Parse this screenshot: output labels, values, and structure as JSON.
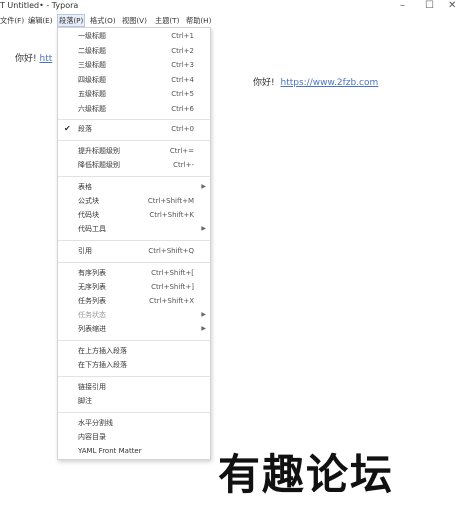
{
  "window": {
    "title": "T  Untitled• - Typora",
    "minimize_glyph": "–",
    "maximize_glyph": "☐",
    "close_glyph": "✕"
  },
  "menubar": {
    "items": [
      "文件(F)",
      "编辑(E)",
      "段落(P)",
      "格式(O)",
      "视图(V)",
      "主题(T)",
      "帮助(H)"
    ],
    "active_index": 2
  },
  "document": {
    "left_text": "你好!",
    "left_link_partial": "htt",
    "right_text": "你好!",
    "right_link": "https://www.2fzb.com"
  },
  "paragraph_menu": {
    "headings": [
      {
        "label": "一级标题",
        "shortcut": "Ctrl+1"
      },
      {
        "label": "二级标题",
        "shortcut": "Ctrl+2"
      },
      {
        "label": "三级标题",
        "shortcut": "Ctrl+3"
      },
      {
        "label": "四级标题",
        "shortcut": "Ctrl+4"
      },
      {
        "label": "五级标题",
        "shortcut": "Ctrl+5"
      },
      {
        "label": "六级标题",
        "shortcut": "Ctrl+6"
      }
    ],
    "paragraph": {
      "label": "段落",
      "shortcut": "Ctrl+0",
      "check": "✔"
    },
    "levels": [
      {
        "label": "提升标题级别",
        "shortcut": "Ctrl+="
      },
      {
        "label": "降低标题级别",
        "shortcut": "Ctrl+-"
      }
    ],
    "blocks": [
      {
        "label": "表格",
        "shortcut": "",
        "submenu": true
      },
      {
        "label": "公式块",
        "shortcut": "Ctrl+Shift+M"
      },
      {
        "label": "代码块",
        "shortcut": "Ctrl+Shift+K"
      },
      {
        "label": "代码工具",
        "shortcut": "",
        "submenu": true
      }
    ],
    "quote": {
      "label": "引用",
      "shortcut": "Ctrl+Shift+Q"
    },
    "lists": [
      {
        "label": "有序列表",
        "shortcut": "Ctrl+Shift+["
      },
      {
        "label": "无序列表",
        "shortcut": "Ctrl+Shift+]"
      },
      {
        "label": "任务列表",
        "shortcut": "Ctrl+Shift+X"
      },
      {
        "label": "任务状态",
        "shortcut": "",
        "submenu": true,
        "disabled": true
      },
      {
        "label": "列表缩进",
        "shortcut": "",
        "submenu": true
      }
    ],
    "insert": [
      {
        "label": "在上方插入段落"
      },
      {
        "label": "在下方插入段落"
      }
    ],
    "notes": [
      {
        "label": "链接引用"
      },
      {
        "label": "脚注"
      }
    ],
    "misc": [
      {
        "label": "水平分割线"
      },
      {
        "label": "内容目录"
      },
      {
        "label": "YAML Front Matter"
      }
    ],
    "arrow_glyph": "▶"
  },
  "watermark": {
    "text": "有趣论坛"
  }
}
